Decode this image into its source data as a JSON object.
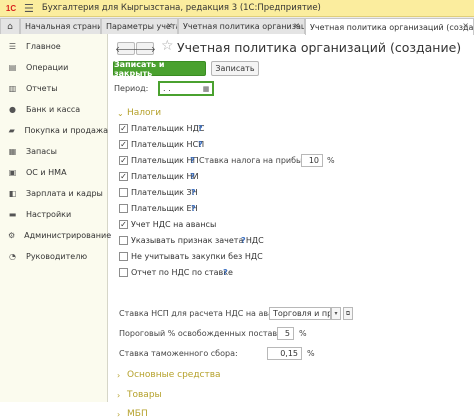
{
  "app": {
    "logo_text": "1С",
    "menu_icon": "hamburger-icon",
    "window_title": "Бухгалтерия для Кыргызстана, редакция 3  (1С:Предприятие)"
  },
  "tabs": [
    {
      "label": "Начальная страница",
      "close": "×"
    },
    {
      "label": "Параметры учета",
      "close": "×"
    },
    {
      "label": "Учетная политика организаций",
      "close": "×"
    },
    {
      "label": "Учетная политика организаций (создание)",
      "close": "×"
    }
  ],
  "sidebar": {
    "items": [
      {
        "label": "Главное",
        "icon": "menu-icon"
      },
      {
        "label": "Операции",
        "icon": "operations-icon"
      },
      {
        "label": "Отчеты",
        "icon": "reports-icon"
      },
      {
        "label": "Банк и касса",
        "icon": "bank-icon"
      },
      {
        "label": "Покупка и продажа",
        "icon": "trade-icon"
      },
      {
        "label": "Запасы",
        "icon": "stock-icon"
      },
      {
        "label": "ОС и НМА",
        "icon": "assets-icon"
      },
      {
        "label": "Зарплата и кадры",
        "icon": "payroll-icon"
      },
      {
        "label": "Настройки",
        "icon": "settings-icon"
      },
      {
        "label": "Администрирование",
        "icon": "gear-icon"
      },
      {
        "label": "Руководителю",
        "icon": "chart-icon"
      }
    ]
  },
  "form": {
    "back": "🡐",
    "forward": "🡒",
    "title": "Учетная политика организаций (создание)",
    "save_close": "Записать и закрыть",
    "save": "Записать",
    "period_label": "Период:",
    "period_value": " .  .    ",
    "taxes_group": "Налоги",
    "checkboxes": [
      {
        "label": "Плательщик НДС",
        "checked": true,
        "help": "?"
      },
      {
        "label": "Плательщик НСП",
        "checked": true,
        "help": "?"
      },
      {
        "label": "Плательщик НП",
        "checked": true,
        "help": "?"
      },
      {
        "label": "Плательщик НИ",
        "checked": true,
        "help": "?"
      },
      {
        "label": "Плательщик ЗН",
        "checked": false,
        "help": "?"
      },
      {
        "label": "Плательщик ЕН",
        "checked": false,
        "help": "?"
      },
      {
        "label": "Учет НДС на авансы",
        "checked": true,
        "help": ""
      },
      {
        "label": "Указывать признак зачета НДС",
        "checked": false,
        "help": "?"
      },
      {
        "label": "Не учитывать закупки без НДС",
        "checked": false,
        "help": ""
      },
      {
        "label": "Отчет по НДС по ставке",
        "checked": false,
        "help": "?"
      }
    ],
    "profit_tax_label": "Ставка налога на прибыль:",
    "profit_tax_value": "10",
    "percent": "%",
    "nsp_label": "Ставка НСП для расчета НДС на авансы:",
    "nsp_value": "Торговля и произ",
    "threshold_label": "Пороговый % освобожденных поставок:",
    "threshold_value": "5",
    "customs_label": "Ставка таможенного сбора:",
    "customs_value": "0,15",
    "group_os": "Основные средства",
    "group_goods": "Товары",
    "group_mbp": "МБП"
  },
  "colors": {
    "accent_green": "#4aa12f",
    "group_header": "#b5a12b",
    "titlebar": "#fbed9e",
    "help": "#3b6fc1"
  }
}
